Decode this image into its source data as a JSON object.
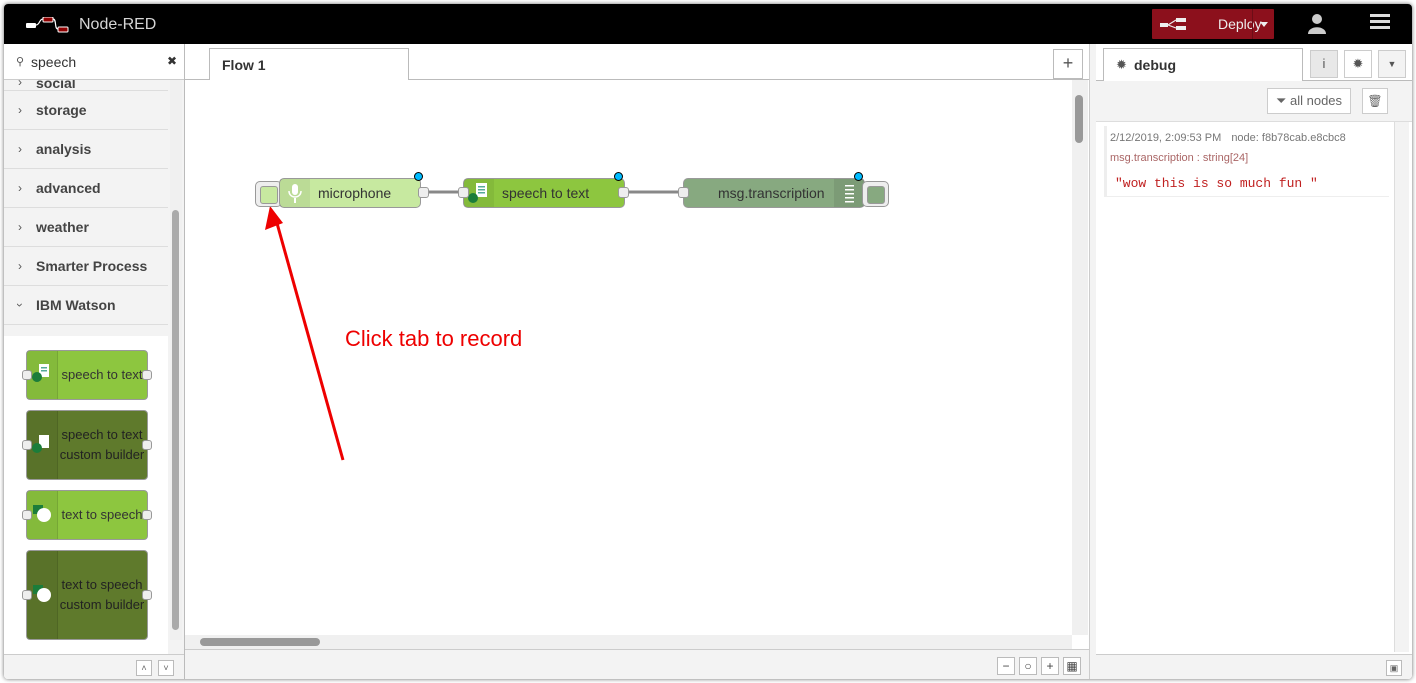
{
  "header": {
    "title": "Node-RED",
    "deploy_label": "Deploy"
  },
  "palette": {
    "search_value": "speech",
    "categories": [
      "social",
      "storage",
      "analysis",
      "advanced",
      "weather",
      "Smarter Process",
      "IBM Watson"
    ],
    "nodes": [
      "speech to text",
      "speech to text custom builder",
      "text to speech",
      "text to speech custom builder"
    ]
  },
  "workspace": {
    "tab_label": "Flow 1",
    "nodes": {
      "microphone": "microphone",
      "stt": "speech to text",
      "debug": "msg.transcription"
    },
    "annotation": "Click tab to record"
  },
  "sidebar": {
    "tab_label": "debug",
    "filter_label": "all nodes",
    "message": {
      "timestamp": "2/12/2019, 2:09:53 PM",
      "node": "node: f8b78cab.e8cbc8",
      "path": "msg.transcription : string[24]",
      "value": "\"wow this is so much fun \""
    }
  },
  "colors": {
    "deploy": "#8c101c",
    "watson_light": "#8dc63f",
    "watson_dark": "#5f7a2c",
    "debug_node": "#87a980",
    "microphone": "#c7e9a0",
    "annotation": "#ee0000"
  }
}
